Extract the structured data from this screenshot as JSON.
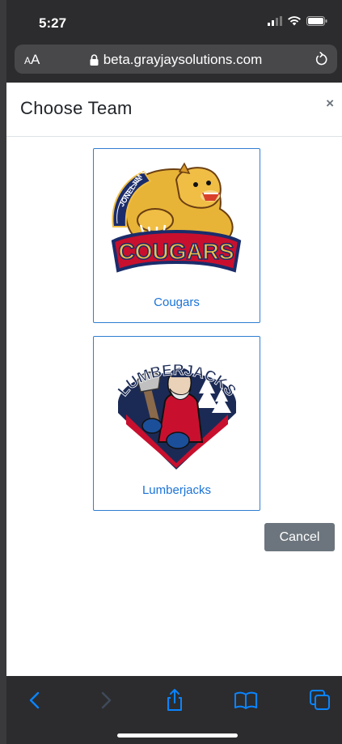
{
  "status_bar": {
    "time": "5:27"
  },
  "browser": {
    "text_size_small": "A",
    "text_size_large": "A",
    "url": "beta.grayjaysolutions.com"
  },
  "modal": {
    "title": "Choose Team",
    "close_label": "×",
    "teams": [
      {
        "name": "Cougars",
        "logo_text": "COUGARS",
        "logo_banner": "JONELJIM GROUP"
      },
      {
        "name": "Lumberjacks",
        "logo_text": "LUMBERJACKS"
      }
    ],
    "cancel_label": "Cancel"
  },
  "colors": {
    "accent": "#1a73d8",
    "card_border": "#2f7fd0",
    "cancel_bg": "#6c757d",
    "chrome_bg": "#2c2c2e",
    "toolbar_active": "#0a84ff"
  }
}
